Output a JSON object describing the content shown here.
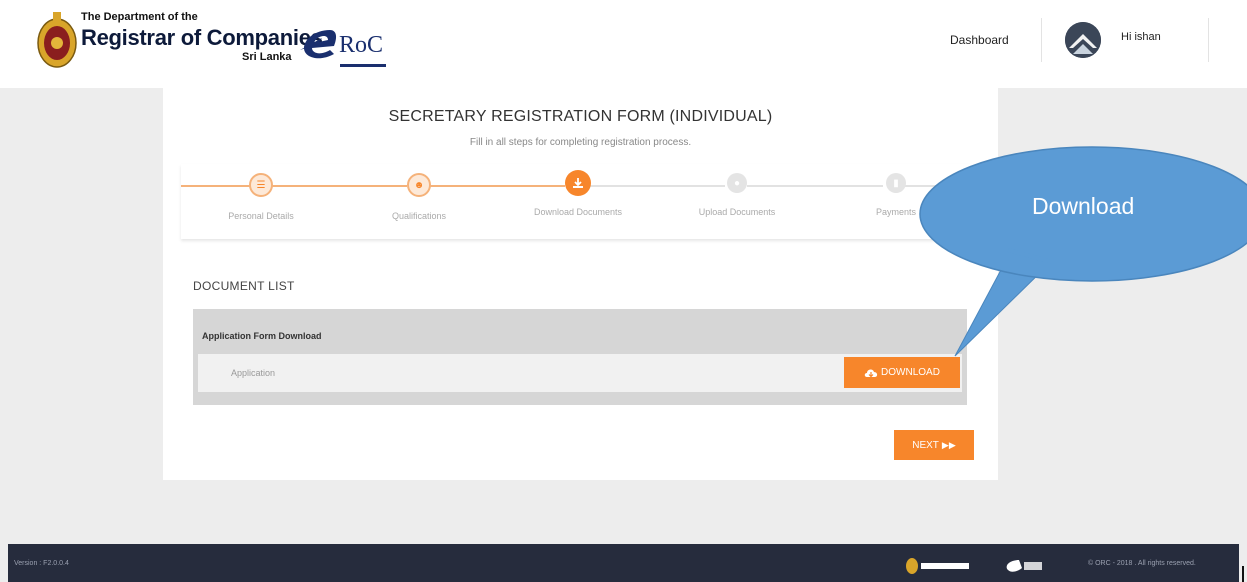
{
  "header": {
    "org_line1": "The Department of the",
    "org_line2": "Registrar of Companies",
    "org_line3": "Sri Lanka",
    "logo_text": "RoC",
    "nav_dashboard": "Dashboard",
    "greeting": "Hi ishan"
  },
  "form": {
    "title": "SECRETARY REGISTRATION FORM (INDIVIDUAL)",
    "subtitle": "Fill in all steps for completing registration process.",
    "steps": [
      {
        "label": "Personal Details",
        "state": "done",
        "icon": "list-icon"
      },
      {
        "label": "Qualifications",
        "state": "done",
        "icon": "users-icon"
      },
      {
        "label": "Download Documents",
        "state": "active",
        "icon": "download-icon"
      },
      {
        "label": "Upload Documents",
        "state": "pending",
        "icon": "upload-icon"
      },
      {
        "label": "Payments",
        "state": "pending",
        "icon": "payment-icon"
      }
    ]
  },
  "documents": {
    "heading": "DOCUMENT LIST",
    "panel_title": "Application Form Download",
    "row_label": "Application",
    "download_label": "DOWNLOAD",
    "next_label": "NEXT"
  },
  "callout": {
    "text": "Download"
  },
  "footer": {
    "version": "Version : F2.0.0.4",
    "copyright": "© ORC - 2018 . All rights reserved."
  },
  "colors": {
    "accent": "#f7862b",
    "footer_bg": "#262c3d",
    "callout": "#5b9bd5"
  }
}
